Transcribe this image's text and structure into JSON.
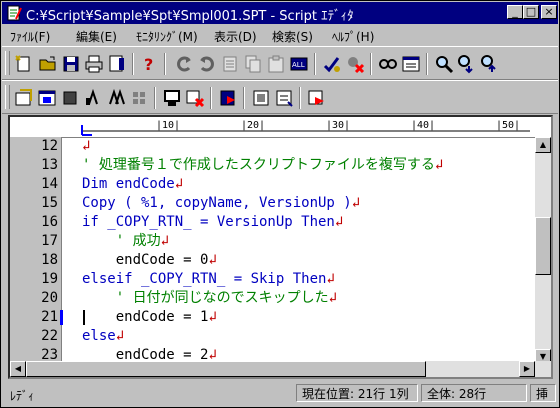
{
  "window": {
    "title": "C:¥Script¥Sample¥Spt¥Smpl001.SPT - Script ｴﾃﾞｨﾀ"
  },
  "title_buttons": {
    "minimize": "_",
    "maximize": "□",
    "close": "×"
  },
  "menu": [
    {
      "label": "ﾌｧｲﾙ(F)"
    },
    {
      "label": "編集(E)"
    },
    {
      "label": "ﾓﾆﾀﾘﾝｸﾞ(M)"
    },
    {
      "label": "表示(D)"
    },
    {
      "label": "検索(S)"
    },
    {
      "label": "ﾍﾙﾌﾟ(H)"
    }
  ],
  "ruler": {
    "marks": [
      {
        "label": "|10|"
      },
      {
        "label": "|20|"
      },
      {
        "label": "|30|"
      },
      {
        "label": "|40|"
      },
      {
        "label": "|50|"
      }
    ]
  },
  "editor": {
    "lines": [
      {
        "number": "12",
        "text": "↲",
        "color": "#c00000"
      },
      {
        "number": "13",
        "text": "' 処理番号１で作成したスクリプトファイルを複写する↲",
        "color": "#008000"
      },
      {
        "number": "14",
        "text": "Dim endCode↲",
        "color": "#0000c0"
      },
      {
        "number": "15",
        "text": "Copy ( %1, copyName, VersionUp )↲",
        "color": "#0000c0"
      },
      {
        "number": "16",
        "text": "if _COPY_RTN_ = VersionUp Then↲",
        "color": "#0000c0"
      },
      {
        "number": "17",
        "text": "    ' 成功↲",
        "color": "#008000"
      },
      {
        "number": "18",
        "text": "    endCode = 0↲",
        "color": "#000000"
      },
      {
        "number": "19",
        "text": "elseif _COPY_RTN_ = Skip Then↲",
        "color": "#0000c0"
      },
      {
        "number": "20",
        "text": "    ' 日付が同じなのでスキップした↲",
        "color": "#008000"
      },
      {
        "number": "21",
        "text": "    endCode = 1↲",
        "color": "#000000"
      },
      {
        "number": "22",
        "text": "else↲",
        "color": "#0000c0"
      },
      {
        "number": "23",
        "text": "    endCode = 2↲",
        "color": "#000000"
      }
    ],
    "current_line": "21"
  },
  "status": {
    "ready": "ﾚﾃﾞｨ",
    "position": "現在位置:  21行  1列",
    "total": "全体:   28行",
    "mode": "挿"
  },
  "toolbars": {
    "row1_icons": [
      "new-file-icon",
      "open-file-icon",
      "save-icon",
      "print-icon",
      "print-preview-icon",
      "help-icon",
      "undo-icon",
      "redo-icon",
      "cut-icon",
      "copy-icon",
      "paste-icon",
      "select-all-icon",
      "check-syntax-icon",
      "delete-icon",
      "replace-icon",
      "properties-icon",
      "find-icon",
      "find-next-icon",
      "find-prev-icon"
    ],
    "row2_icons": [
      "run-icon",
      "window-icon",
      "stop-icon",
      "step-icon",
      "step-over-icon",
      "breakpoints-icon",
      "monitor-icon",
      "clear-icon",
      "bookmark-icon",
      "list-icon",
      "list-add-icon",
      "trace-icon"
    ]
  },
  "colors": {
    "title_bg": "#000080",
    "chrome": "#c0c0c0",
    "comment": "#008000",
    "keyword": "#0000c0",
    "linefeed": "#c00000"
  }
}
